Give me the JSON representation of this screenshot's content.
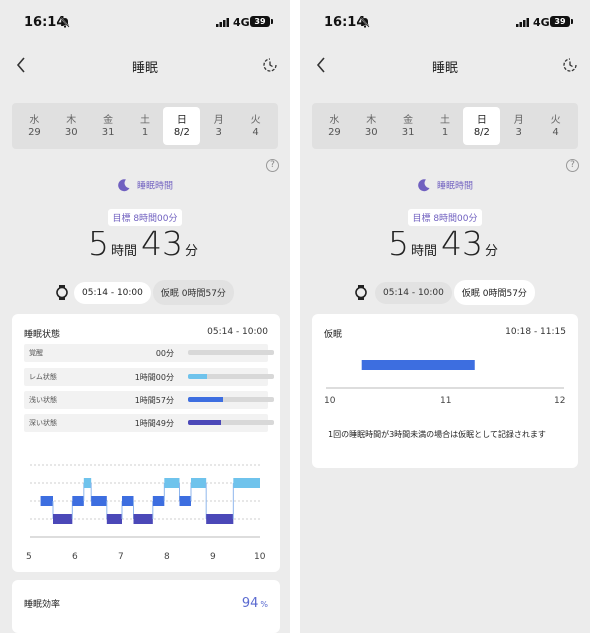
{
  "status_bar": {
    "time": "16:14",
    "network": "4G",
    "battery": "39"
  },
  "nav": {
    "title": "睡眠"
  },
  "dates": [
    {
      "weekday": "水",
      "date": "29",
      "selected": false
    },
    {
      "weekday": "木",
      "date": "30",
      "selected": false
    },
    {
      "weekday": "金",
      "date": "31",
      "selected": false
    },
    {
      "weekday": "土",
      "date": "1",
      "selected": false
    },
    {
      "weekday": "日",
      "date": "8/2",
      "selected": true
    },
    {
      "weekday": "月",
      "date": "3",
      "selected": false
    },
    {
      "weekday": "火",
      "date": "4",
      "selected": false
    }
  ],
  "summary": {
    "header": "睡眠時間",
    "goal": "目標 8時間00分",
    "hours": "5",
    "hours_unit": "時間",
    "minutes": "43",
    "minutes_unit": "分",
    "main_range": "05:14 - 10:00",
    "nap_label": "仮眠 0時間57分"
  },
  "sleep_state": {
    "title": "睡眠状態",
    "range": "05:14 - 10:00",
    "stages": [
      {
        "label": "覚醒",
        "value": "00分",
        "fraction": 0.0,
        "color": "#cccccc"
      },
      {
        "label": "レム状態",
        "value": "1時間00分",
        "fraction": 0.22,
        "color": "#6fc3ec"
      },
      {
        "label": "浅い状態",
        "value": "1時間57分",
        "fraction": 0.41,
        "color": "#3d6ee0"
      },
      {
        "label": "深い状態",
        "value": "1時間49分",
        "fraction": 0.38,
        "color": "#4b48b8"
      }
    ],
    "axis_ticks": [
      "5",
      "6",
      "7",
      "8",
      "9",
      "10"
    ]
  },
  "hypnogram": {
    "x_range": [
      5,
      10
    ],
    "levels": [
      "REM",
      "浅い",
      "深い"
    ],
    "segments": [
      {
        "start": 5.23,
        "end": 5.5,
        "level": 1
      },
      {
        "start": 5.5,
        "end": 5.92,
        "level": 2
      },
      {
        "start": 5.92,
        "end": 6.17,
        "level": 1
      },
      {
        "start": 6.17,
        "end": 6.33,
        "level": 0
      },
      {
        "start": 6.33,
        "end": 6.67,
        "level": 1
      },
      {
        "start": 6.67,
        "end": 7.0,
        "level": 2
      },
      {
        "start": 7.0,
        "end": 7.25,
        "level": 1
      },
      {
        "start": 7.25,
        "end": 7.67,
        "level": 2
      },
      {
        "start": 7.67,
        "end": 7.92,
        "level": 1
      },
      {
        "start": 7.92,
        "end": 8.25,
        "level": 0
      },
      {
        "start": 8.25,
        "end": 8.5,
        "level": 1
      },
      {
        "start": 8.5,
        "end": 8.83,
        "level": 0
      },
      {
        "start": 8.83,
        "end": 9.42,
        "level": 2
      },
      {
        "start": 9.42,
        "end": 10.0,
        "level": 0
      }
    ],
    "colors": [
      "#6fc3ec",
      "#3d6ee0",
      "#4b48b8"
    ]
  },
  "efficiency": {
    "label": "睡眠効率",
    "value": "94",
    "unit": "%"
  },
  "nap": {
    "title": "仮眠",
    "range": "10:18 - 11:15",
    "start": 10.3,
    "end": 11.25,
    "axis_ticks": [
      "10",
      "11",
      "12"
    ],
    "x_range": [
      10,
      12
    ],
    "color": "#3d6ee0",
    "note": "1回の睡眠時間が3時間未満の場合は仮眠として記録されます"
  }
}
